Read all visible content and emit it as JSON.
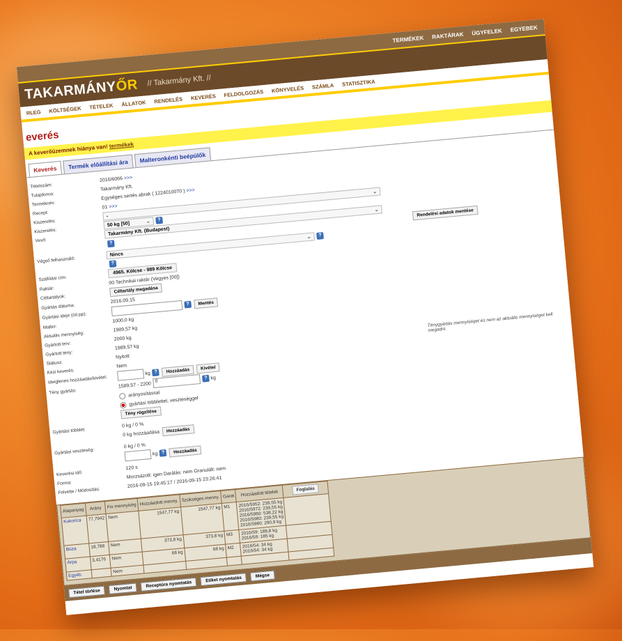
{
  "top_nav": [
    "TERMÉKEK",
    "RAKTÁRAK",
    "ÜGYFELEK",
    "EGYEBEK"
  ],
  "brand": {
    "part1": "TAKARMÁNY",
    "part2": "ŐR",
    "company": "// Takarmány Kft. //"
  },
  "main_nav": [
    "RLEG",
    "KÖLTSÉGEK",
    "TÉTELEK",
    "ÁLLATOK",
    "RENDELÉS",
    "KEVERÉS",
    "FELDOLGOZÁS",
    "KÖNYVELÉS",
    "SZÁMLA",
    "STATISZTIKA"
  ],
  "page_title": "everés",
  "alert": {
    "text": "A keverőüzemnek hiánya van!",
    "link": "termékek"
  },
  "tabs": [
    "Keverés",
    "Termék előállítási ára",
    "Malteronkénti beépülők"
  ],
  "fields": {
    "tetelszam": {
      "label": "Tételszám:",
      "value": "2016/6066",
      "link": ">>>"
    },
    "tulajdonos": {
      "label": "Tulajdonos:",
      "value": "Takarmány Kft."
    },
    "termeknev": {
      "label": "Terméknév:",
      "value": "Egységes sertés abrak ( 1224010070 )",
      "link": ">>>"
    },
    "recept": {
      "label": "Recept:",
      "value": "01",
      "link": ">>>"
    },
    "kiszereles1": {
      "label": "Kiszerelés:",
      "value": "-"
    },
    "kiszereles2": {
      "label": "Kiszerelés:",
      "value": "50 kg [50]"
    },
    "vevo": {
      "label": "Vevő:",
      "value": "Takarmány Kft. (Budapest)"
    },
    "vegso": {
      "label": "Végső felhasználó:",
      "value": "Nincs"
    },
    "szallitasi": {
      "label": "Szállítási cím:",
      "value": "4965. Kölcse - 989 Kölcse"
    },
    "raktar": {
      "label": "Raktár:",
      "value": "00 Technikai raktár (Vegyes [00])"
    },
    "celtartalyok": {
      "label": "Céltartályok:",
      "button": "Céltartály megadása"
    },
    "gyartas_datuma": {
      "label": "Gyártás dátuma:",
      "value": "2016.09.15"
    },
    "gyartasi_ideje": {
      "label": "Gyártási ideje (óó:pp):",
      "button": "Mentés"
    },
    "malter": {
      "label": "Malter:",
      "value": "1000,0 kg"
    },
    "aktualis": {
      "label": "Aktuális mennyiség:",
      "value": "1989,57 kg"
    },
    "gyartott_terv": {
      "label": "Gyártott terv:",
      "value": "2000 kg"
    },
    "gyartott_teny": {
      "label": "Gyártott tény:",
      "value": "1989,57 kg"
    },
    "statusz": {
      "label": "Státusz:",
      "value": "Nyitott"
    },
    "kezi": {
      "label": "Kézi keverés:",
      "value": "Nem"
    },
    "ideiglenes": {
      "label": "Ideiglenes hozzáadás/kivétel:",
      "unit": "kg",
      "add": "Hozzáadás",
      "remove": "Kivétel"
    },
    "teny_gyartas": {
      "label": "Tény gyártás:",
      "range": "1589,57 - 2200",
      "input": "0",
      "unit": "kg"
    },
    "radio1": "arányosítással",
    "radio2": "gyártási többlettel, veszteséggel",
    "teny_button": "Tény rögzítése",
    "tobblet": {
      "label": "Gyártási többlet:",
      "line1": "0 kg / 0 %",
      "line2": "0 kg hozzáadása",
      "button": "Hozzáadás"
    },
    "veszteseg": {
      "label": "Gyártási veszteség:",
      "line1": "0 kg / 0 %",
      "unit": "kg",
      "button": "Hozzáadás"
    },
    "keveresi_ido": {
      "label": "Keverési idő:",
      "value": "120 s"
    },
    "forma": {
      "label": "Forma:",
      "value": "Morzsázott: igen   Darálás: nem   Granulált: nem"
    },
    "felvette": {
      "label": "Felvette / Módosítás:",
      "value": "2016-09-15 19:45:17 / 2016-09-15 23:26:41"
    }
  },
  "rendeles_button": "Rendelési adatok mentése",
  "note": "Ténygyártás mennyiséget és nem az aktuális mennyiséget kell megadni.",
  "table": {
    "headers": [
      "Alapanyag",
      "Arány",
      "Fix mennyiség",
      "Hozzáadott menny.",
      "Szükséges menny.",
      "Garat",
      "Hozzáadott tételek"
    ],
    "foglalas": "Foglalás",
    "rows": [
      {
        "name": "Kukorica",
        "arany": "77,7942",
        "fix": "Nem",
        "hozz": "1547,77 kg",
        "szuks": "1547,77 kg",
        "garat": "M1",
        "tetelek": [
          "2016/5952: 239,55 kg",
          "2016/5972: 239,55 kg",
          "2016/5980: 538,22 kg",
          "2016/5980: 239,55 kg",
          "2016/5980: 290,9 kg"
        ]
      },
      {
        "name": "Búza",
        "arany": "18,788",
        "fix": "Nem",
        "hozz": "373,8 kg",
        "szuks": "373,8 kg",
        "garat": "M3",
        "tetelek": [
          "2016/59: 188,8 kg",
          "2016/59: 185 kg"
        ]
      },
      {
        "name": "Árpa",
        "arany": "3,4176",
        "fix": "Nem",
        "hozz": "68 kg",
        "szuks": "68 kg",
        "garat": "M2",
        "tetelek": [
          "2016/54: 34 kg",
          "2016/54: 34 kg"
        ]
      },
      {
        "name": "Egyéb",
        "arany": "",
        "fix": "Nem",
        "hozz": "",
        "szuks": "",
        "garat": "",
        "tetelek": []
      }
    ]
  },
  "bottom_buttons": [
    "Tétel törlése",
    "Nyomtat",
    "Receptúra nyomtatás",
    "Etiket nyomtatás",
    "Mégse"
  ]
}
